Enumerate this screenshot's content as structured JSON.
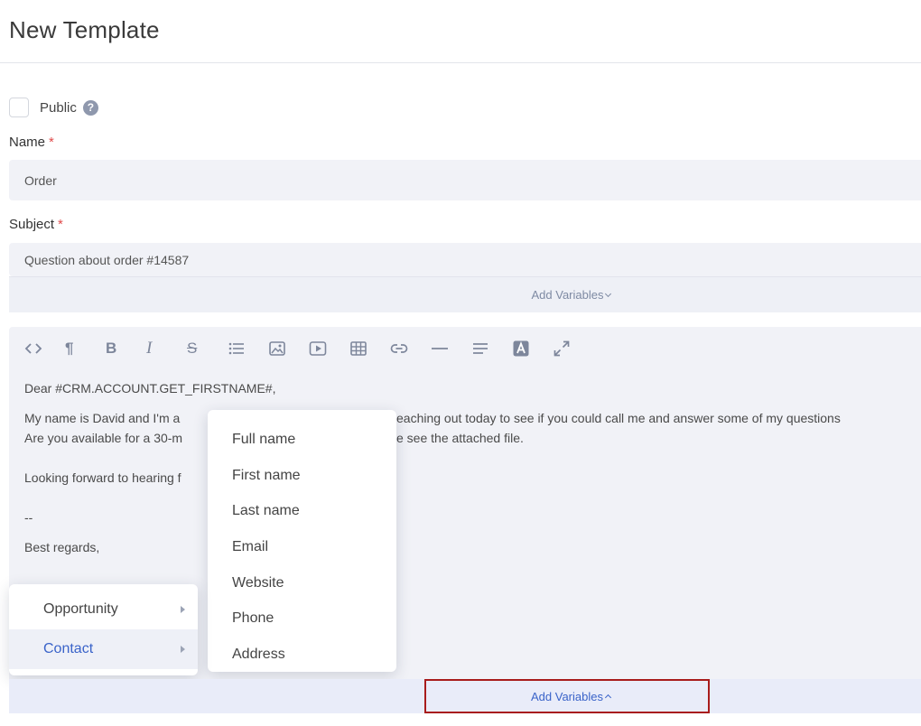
{
  "page": {
    "title": "New Template"
  },
  "public": {
    "label": "Public",
    "checked": false,
    "help_icon": "question-circle-icon"
  },
  "name_field": {
    "label": "Name",
    "required_mark": "*",
    "value": "Order"
  },
  "subject_field": {
    "label": "Subject",
    "required_mark": "*",
    "value": "Question about order #14587"
  },
  "subject_add_variables": "Add Variables",
  "toolbar": {
    "icons": [
      "code-icon",
      "paragraph-icon",
      "bold-icon",
      "italic-icon",
      "strikethrough-icon",
      "bulleted-list-icon",
      "image-icon",
      "video-icon",
      "table-icon",
      "link-icon",
      "horizontal-rule-icon",
      "align-icon",
      "text-color-icon",
      "fullscreen-icon"
    ],
    "paragraph_glyph": "¶",
    "bold_glyph": "B",
    "italic_glyph": "I",
    "strike_glyph": "S"
  },
  "body": {
    "greeting": "Dear #CRM.ACCOUNT.GET_FIRSTNAME#,",
    "line1": "My name is David and I'm a",
    "line1_right": "eaching out today to see if you could call me and answer some of my questions",
    "line2": "Are you available for a 30-m",
    "line2_right": "e see the attached file.",
    "line3": "Looking forward to hearing f",
    "separator": "--",
    "regards": "Best regards,"
  },
  "variables_menu": {
    "categories": [
      {
        "label": "Opportunity",
        "active": false
      },
      {
        "label": "Contact",
        "active": true
      }
    ],
    "contact_fields": [
      "Full name",
      "First name",
      "Last name",
      "Email",
      "Website",
      "Phone",
      "Address"
    ]
  },
  "bottom_add_variables": "Add Variables",
  "colors": {
    "accent": "#3a63c9",
    "required": "#e04a4a",
    "highlight_border": "#a81c1c"
  }
}
